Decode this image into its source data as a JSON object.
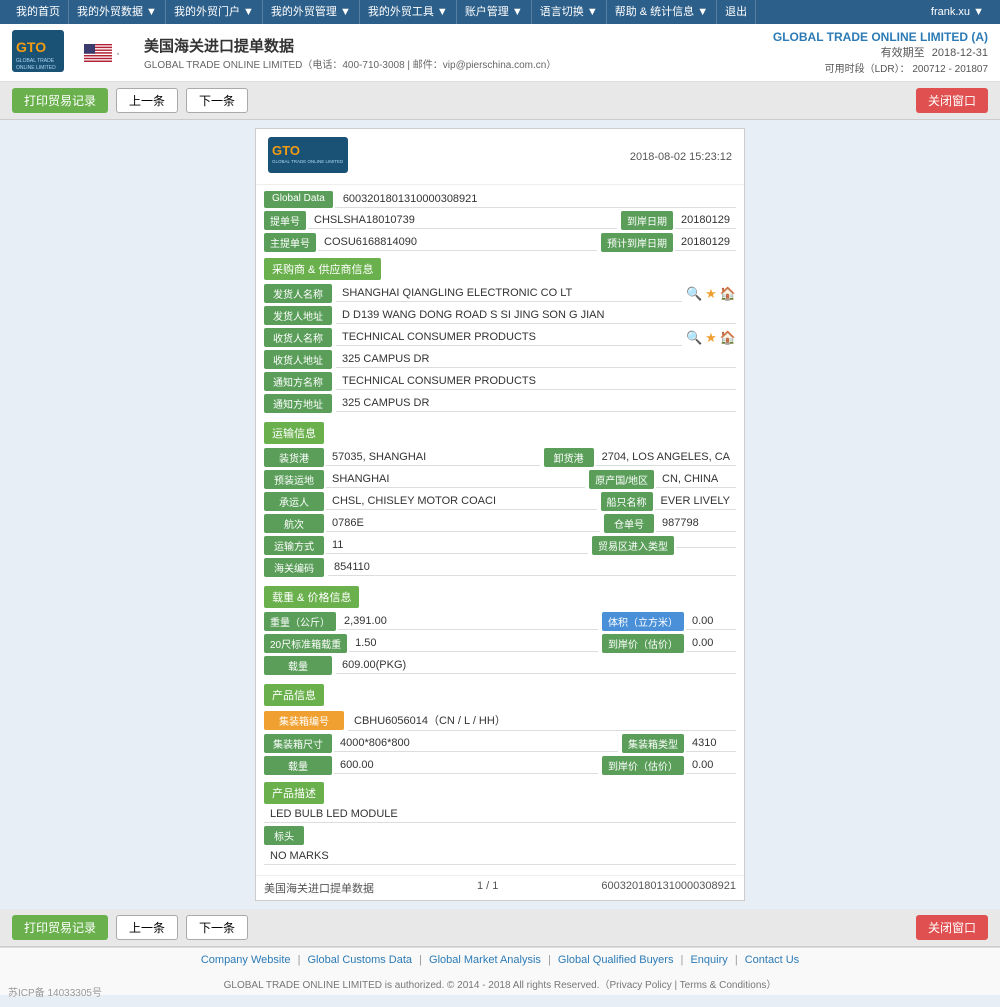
{
  "topnav": {
    "items": [
      "我的首页",
      "我的外贸数据 ▼",
      "我的外贸门户 ▼",
      "我的外贸管理 ▼",
      "我的外贸工具 ▼",
      "账户管理 ▼",
      "语言切换 ▼",
      "帮助 & 统计信息 ▼",
      "退出"
    ],
    "user": "frank.xu ▼"
  },
  "header": {
    "logo": "GTO",
    "logo_sub": "GLOBAL TRADE ONLINE LIMITED",
    "flag_alt": "US Flag",
    "title": "美国海关进口提单数据 ·",
    "subtitle": "GLOBAL TRADE ONLINE LIMITED（电话：400-710-3008 | 邮件：vip@pierschina.com.cn）",
    "company": "GLOBAL TRADE ONLINE LIMITED (A)",
    "valid_label": "有效期至",
    "valid_date": "2018-12-31",
    "ldr_label": "可用时段（LDR）：",
    "ldr_value": "200712 - 201807"
  },
  "toolbar": {
    "print_btn": "打印贸易记录",
    "prev_btn": "上一条",
    "next_btn": "下一条",
    "close_btn": "关闭窗口"
  },
  "doc": {
    "logo": "GTO",
    "logo_sub": "GLOBAL TRADE\nONLINE LIMITED",
    "datetime": "2018-08-02  15:23:12",
    "global_data_label": "Global Data",
    "global_data_value": "6003201801310000308921",
    "bill_label": "提单号",
    "bill_value": "CHSLSHA18010739",
    "arrival_date_label": "到岸日期",
    "arrival_date_value": "20180129",
    "master_bill_label": "主提单号",
    "master_bill_value": "COSU6168814090",
    "est_arrival_label": "预计到岸日期",
    "est_arrival_value": "20180129",
    "sections": {
      "buyer_supplier": "采购商 & 供应商信息",
      "shipping": "运输信息",
      "weight_price": "载重 & 价格信息",
      "product": "产品信息"
    },
    "shipper_name_label": "发货人名称",
    "shipper_name_value": "SHANGHAI QIANGLING ELECTRONIC CO LT",
    "shipper_addr_label": "发货人地址",
    "shipper_addr_value": "D D139 WANG DONG ROAD S SI JING SON G JIAN",
    "consignee_name_label": "收货人名称",
    "consignee_name_value": "TECHNICAL CONSUMER PRODUCTS",
    "consignee_addr_label": "收货人地址",
    "consignee_addr_value": "325 CAMPUS DR",
    "notify_name_label": "通知方名称",
    "notify_name_value": "TECHNICAL CONSUMER PRODUCTS",
    "notify_addr_label": "通知方地址",
    "notify_addr_value": "325 CAMPUS DR",
    "load_port_label": "装货港",
    "load_port_value": "57035, SHANGHAI",
    "discharge_port_label": "卸货港",
    "discharge_port_value": "2704, LOS ANGELES, CA",
    "pre_transport_label": "预装运地",
    "pre_transport_value": "SHANGHAI",
    "origin_label": "原产国/地区",
    "origin_value": "CN, CHINA",
    "carrier_label": "承运人",
    "carrier_value": "CHSL, CHISLEY MOTOR COACI",
    "vessel_label": "船只名称",
    "vessel_value": "EVER LIVELY",
    "voyage_label": "航次",
    "voyage_value": "0786E",
    "warehouse_label": "仓单号",
    "warehouse_value": "987798",
    "transport_mode_label": "运输方式",
    "transport_mode_value": "11",
    "ftz_type_label": "贸易区进入类型",
    "ftz_type_value": "",
    "customs_code_label": "海关编码",
    "customs_code_value": "854110",
    "weight_label": "重量（公斤）",
    "weight_value": "2,391.00",
    "volume_label": "体积（立方米）",
    "volume_value": "0.00",
    "teu_label": "20尺标准箱载重",
    "teu_value": "1.50",
    "est_price_label": "到岸价（估价）",
    "est_price_value": "0.00",
    "quantity_label": "载量",
    "quantity_value": "609.00(PKG)",
    "container_no_label": "集装箱编号",
    "container_no_value": "CBHU6056014（CN / L / HH）",
    "container_size_label": "集装箱尺寸",
    "container_size_value": "4000*806*800",
    "container_type_label": "集装箱类型",
    "container_type_value": "4310",
    "product_quantity_label": "载量",
    "product_quantity_value": "600.00",
    "product_price_label": "到岸价（估价）",
    "product_price_value": "0.00",
    "product_desc_title": "产品描述",
    "product_desc_value": "LED BULB LED MODULE",
    "marks_label": "标头",
    "marks_value": "NO MARKS",
    "pagination": "1 / 1",
    "pagination_id": "6003201801310000308921",
    "data_title": "美国海关进口提单数据"
  },
  "footer": {
    "links": [
      "Company Website",
      "Global Customs Data",
      "Global Market Analysis",
      "Global Qualified Buyers",
      "Enquiry",
      "Contact Us"
    ],
    "copyright": "GLOBAL TRADE ONLINE LIMITED is authorized. © 2014 - 2018 All rights Reserved.（Privacy Policy | Terms & Conditions）",
    "icp": "苏ICP备 14033305号"
  }
}
